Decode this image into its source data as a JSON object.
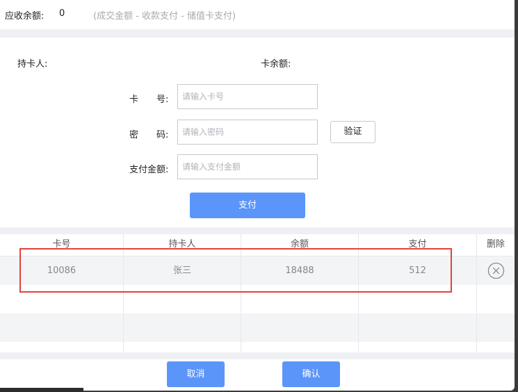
{
  "top": {
    "receivable_label": "应收余额:",
    "receivable_value": "0",
    "receivable_hint": "(成交金额 - 收款支付 - 储值卡支付)"
  },
  "card_info": {
    "holder_label": "持卡人:",
    "balance_label": "卡余额:"
  },
  "form": {
    "card_no_label": "卡　　号:",
    "card_no_placeholder": "请输入卡号",
    "password_label": "密　　码:",
    "password_placeholder": "请输入密码",
    "verify_button": "验证",
    "amount_label": "支付金额:",
    "amount_placeholder": "请输入支付金额",
    "pay_button": "支付"
  },
  "table": {
    "headers": [
      "卡号",
      "持卡人",
      "余额",
      "支付",
      "删除"
    ],
    "rows": [
      [
        "10086",
        "张三",
        "18488",
        "512"
      ]
    ]
  },
  "footer": {
    "cancel_button": "取消",
    "confirm_button": "确认"
  },
  "colors": {
    "accent": "#5b95f9",
    "highlight": "#e3403b",
    "band": "#eef0f4"
  }
}
